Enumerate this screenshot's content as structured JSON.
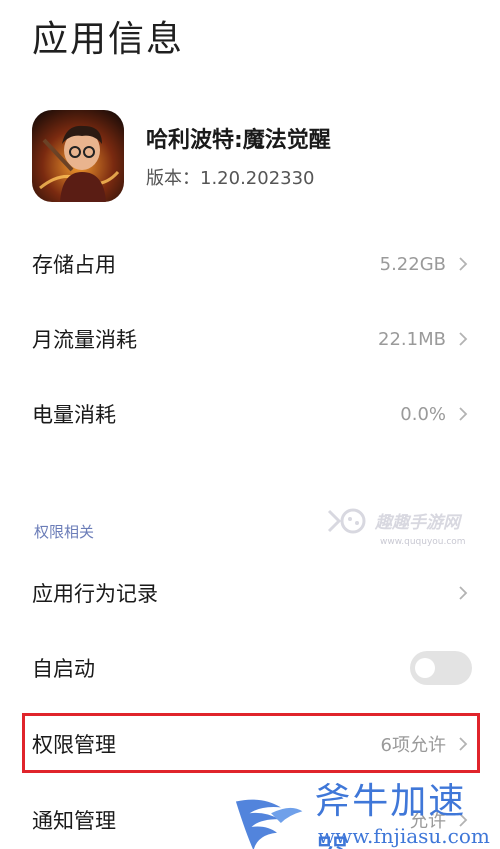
{
  "header": {
    "title": "应用信息"
  },
  "app": {
    "name": "哈利波特:魔法觉醒",
    "version": "版本：1.20.202330"
  },
  "rows": {
    "storage": {
      "label": "存储占用",
      "value": "5.22GB"
    },
    "data_usage": {
      "label": "月流量消耗",
      "value": "22.1MB"
    },
    "battery": {
      "label": "电量消耗",
      "value": "0.0%"
    }
  },
  "permissions_section": {
    "label": "权限相关",
    "behavior_log": {
      "label": "应用行为记录"
    },
    "autostart": {
      "label": "自启动",
      "enabled": false
    },
    "permission_manage": {
      "label": "权限管理",
      "value": "6项允许"
    },
    "notification_manage": {
      "label": "通知管理",
      "value": "允许"
    }
  },
  "watermarks": {
    "quqv": {
      "text": "趣趣手游网",
      "url": "www.ququyou.com"
    },
    "fnjiasu": {
      "text": "斧牛加速器",
      "url": "www.fnjiasu.com"
    }
  },
  "colors": {
    "highlight_border": "#e0242b",
    "section_label": "#6b7db8",
    "watermark_blue": "#3f77d8",
    "value_gray": "#9a9a9a"
  }
}
